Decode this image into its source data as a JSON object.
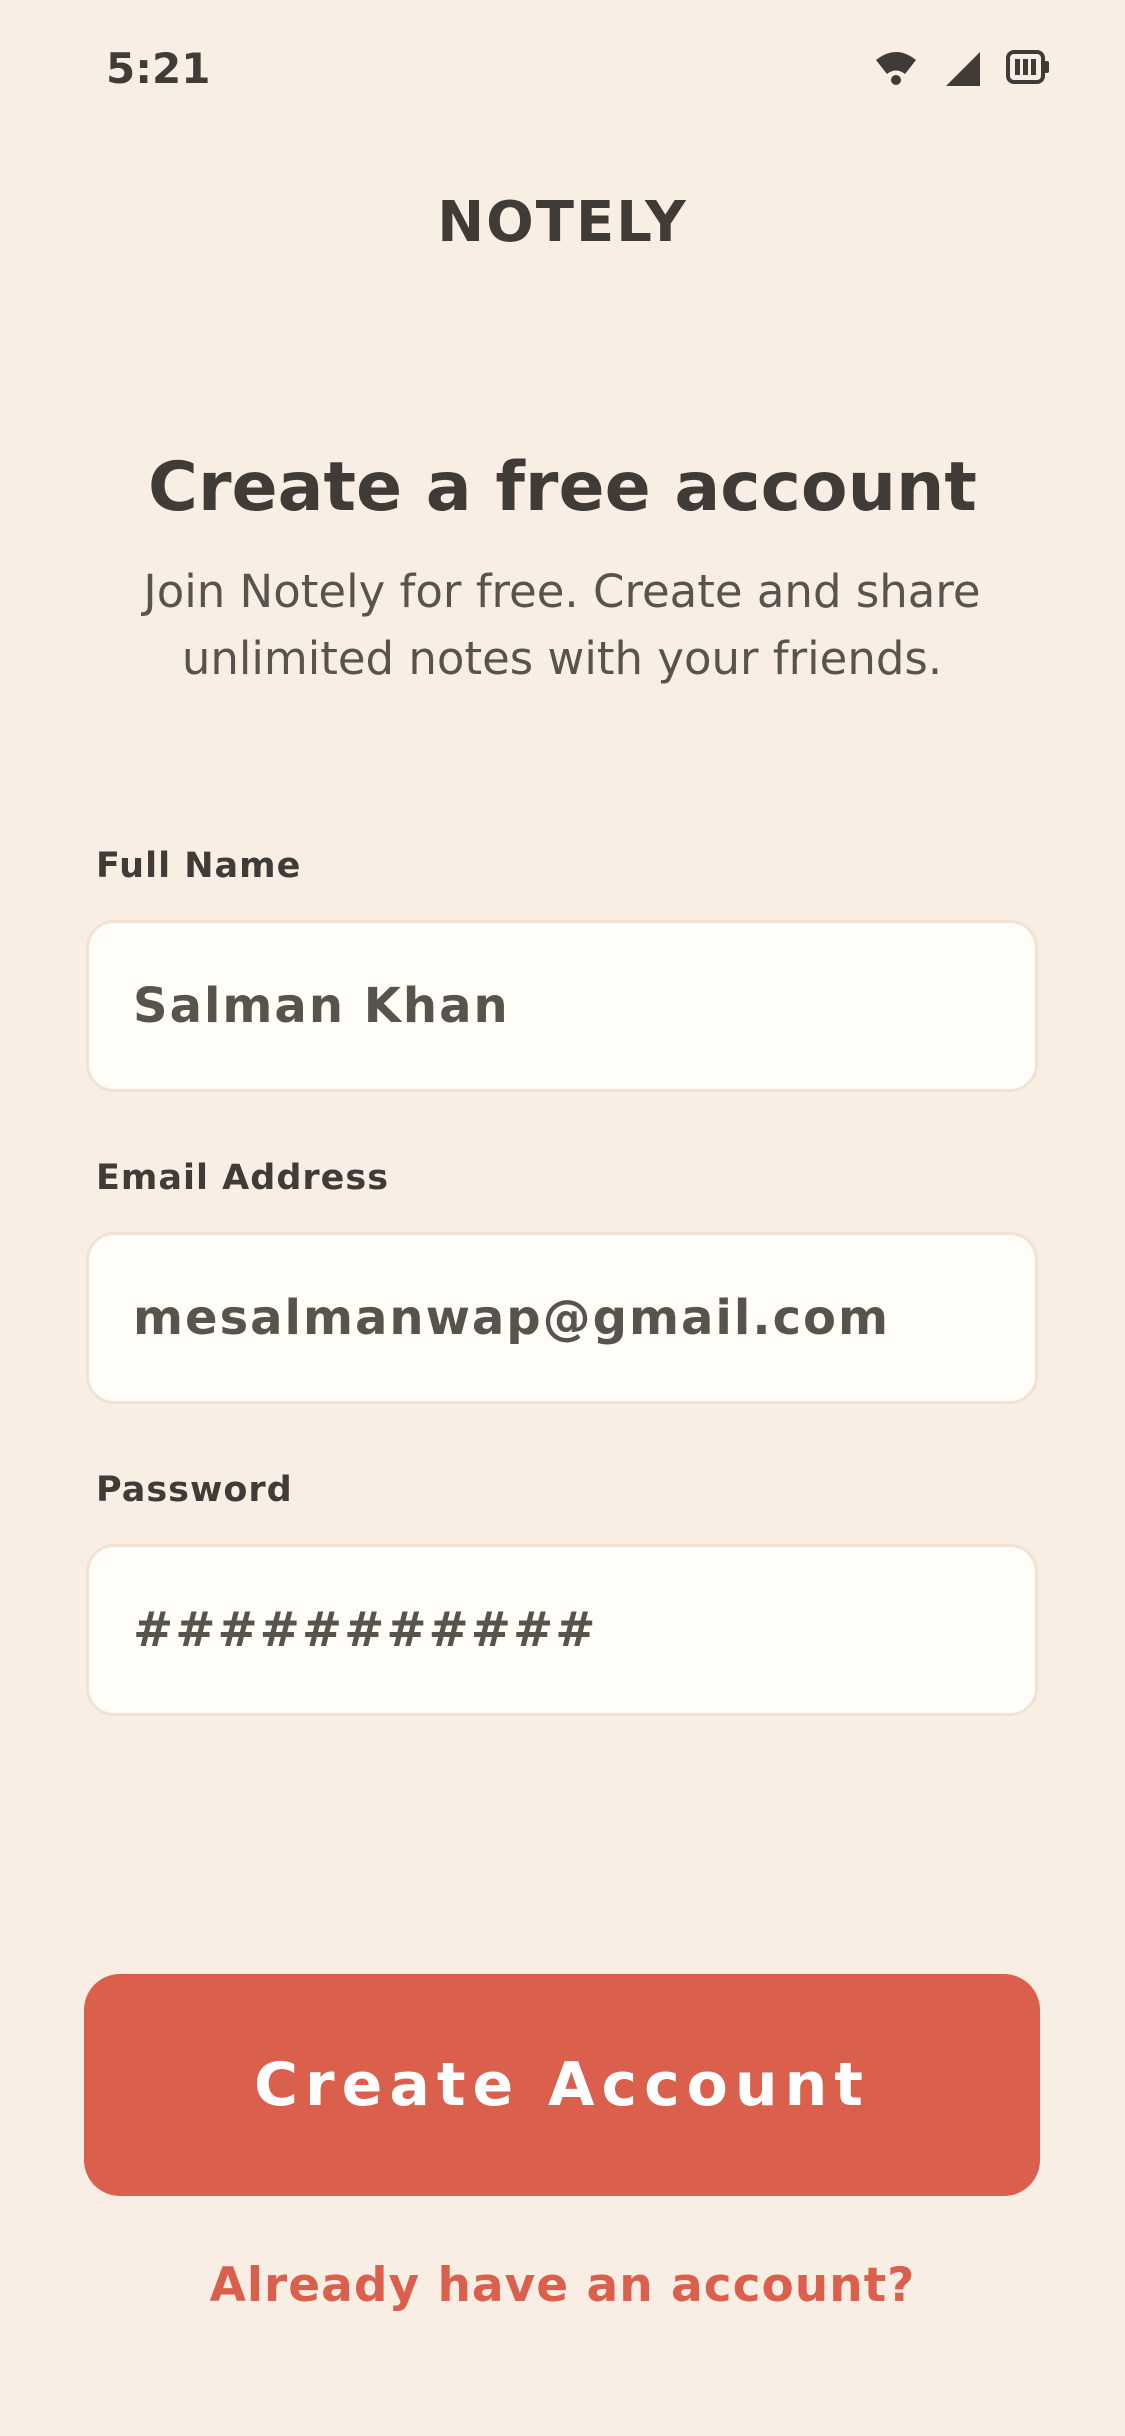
{
  "status_bar": {
    "time": "5:21",
    "icons": [
      "wifi-icon",
      "signal-icon",
      "battery-icon"
    ]
  },
  "brand": {
    "name": "NOTELY"
  },
  "header": {
    "title": "Create a free account",
    "subtitle_line1": "Join Notely for free. Create and share",
    "subtitle_line2": "unlimited notes with your friends."
  },
  "form": {
    "full_name": {
      "label": "Full Name",
      "value": "Salman Khan"
    },
    "email": {
      "label": "Email Address",
      "value": "mesalmanwap@gmail.com"
    },
    "password": {
      "label": "Password",
      "value": "###########"
    }
  },
  "actions": {
    "create_account_label": "Create Account",
    "login_link_label": "Already have an account?"
  },
  "colors": {
    "background": "#F8EEE4",
    "text_dark": "#403B36",
    "accent": "#DA604D",
    "input_background": "#FFFDF8"
  }
}
